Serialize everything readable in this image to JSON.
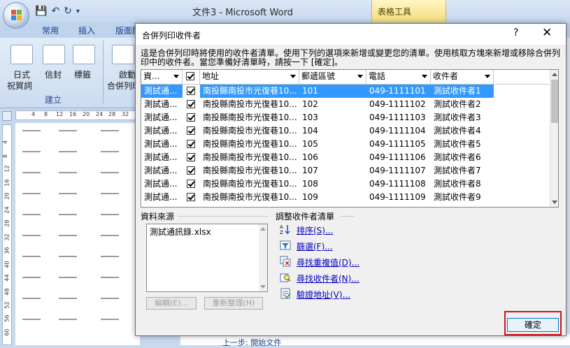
{
  "word": {
    "doc_title": "文件3 - Microsoft Word",
    "table_tools": "表格工具",
    "tabs": [
      "常用",
      "插入",
      "版面配"
    ],
    "ribbon": {
      "btn_start_label1": "日式",
      "btn_start_label2": "祝賀詞",
      "btn_envelope": "信封",
      "btn_labels": "標籤",
      "btn_mailmerge1": "啟動",
      "btn_mailmerge2": "合併列印",
      "group_create": "建立"
    },
    "ruler_h": [
      "4",
      "8",
      "12",
      "16",
      "20",
      "24",
      "28",
      "32"
    ],
    "ruler_v": [
      "4",
      "8",
      "12",
      "16",
      "20",
      "24",
      "28",
      "32",
      "36",
      "40",
      "44",
      "48",
      "52",
      "56",
      "60"
    ],
    "task_pane_link": "上一步: 開始文件"
  },
  "dialog": {
    "title": "合併列印收件者",
    "help": "?",
    "close": "✕",
    "description": "這是合併列印時將使用的收件者清單。使用下列的選項來新增或變更您的清單。使用核取方塊來新增或移除合併列印中的收件者。當您準備好清單時，請按一下 [確定]。",
    "columns": [
      "資...",
      "",
      "地址",
      "郵遞區號",
      "電話",
      "收件者"
    ],
    "rows": [
      {
        "source": "測試通...",
        "checked": true,
        "address": "南投縣南投市光復巷10...",
        "zip": "101",
        "phone": "049-1111101",
        "name": "測試收件者1",
        "selected": true
      },
      {
        "source": "測試通...",
        "checked": true,
        "address": "南投縣南投市光復巷10...",
        "zip": "102",
        "phone": "049-1111102",
        "name": "測試收件者2"
      },
      {
        "source": "測試通...",
        "checked": true,
        "address": "南投縣南投市光復巷10...",
        "zip": "103",
        "phone": "049-1111103",
        "name": "測試收件者3"
      },
      {
        "source": "測試通...",
        "checked": true,
        "address": "南投縣南投市光復巷10...",
        "zip": "104",
        "phone": "049-1111104",
        "name": "測試收件者4"
      },
      {
        "source": "測試通...",
        "checked": true,
        "address": "南投縣南投市光復巷10...",
        "zip": "105",
        "phone": "049-1111105",
        "name": "測試收件者5"
      },
      {
        "source": "測試通...",
        "checked": true,
        "address": "南投縣南投市光復巷10...",
        "zip": "106",
        "phone": "049-1111106",
        "name": "測試收件者6"
      },
      {
        "source": "測試通...",
        "checked": true,
        "address": "南投縣南投市光復巷10...",
        "zip": "107",
        "phone": "049-1111107",
        "name": "測試收件者7"
      },
      {
        "source": "測試通...",
        "checked": true,
        "address": "南投縣南投市光復巷10...",
        "zip": "108",
        "phone": "049-1111108",
        "name": "測試收件者8"
      },
      {
        "source": "測試通...",
        "checked": true,
        "address": "南投縣南投市光復巷10...",
        "zip": "109",
        "phone": "049-1111109",
        "name": "測試收件者9"
      }
    ],
    "data_source": {
      "label": "資料來源",
      "item": "測試通訊錄.xlsx",
      "edit_button": "編輯(E)...",
      "refresh_button": "重新整理(H)"
    },
    "refine": {
      "label": "調整收件者清單",
      "sort": "排序(S)...",
      "filter": "篩選(F)...",
      "find_duplicates": "尋找重複值(D)...",
      "find_recipient": "尋找收件者(N)...",
      "validate": "驗證地址(V)..."
    },
    "ok_button": "確定",
    "colors": {
      "selection": "#3399ff",
      "link": "#0000c0",
      "highlight": "#d0101a"
    }
  }
}
